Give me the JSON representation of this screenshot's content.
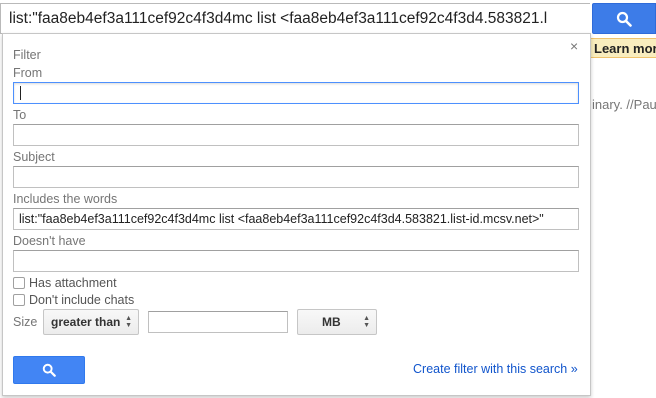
{
  "search": {
    "query": "list:\"faa8eb4ef3a111cef92c4f3d4mc list <faa8eb4ef3a111cef92c4f3d4.583821.l",
    "button_icon": "search-icon"
  },
  "background": {
    "learn_more": "Learn more",
    "snippet": "inary. //Paul"
  },
  "filter": {
    "close_glyph": "×",
    "heading": "Filter",
    "from_label": "From",
    "from_value": "",
    "to_label": "To",
    "to_value": "",
    "subject_label": "Subject",
    "subject_value": "",
    "includes_label": "Includes the words",
    "includes_value": "list:\"faa8eb4ef3a111cef92c4f3d4mc list <faa8eb4ef3a111cef92c4f3d4.583821.list-id.mcsv.net>\"",
    "doesnt_have_label": "Doesn't have",
    "doesnt_have_value": "",
    "has_attachment_label": "Has attachment",
    "no_chats_label": "Don't include chats",
    "size_label": "Size",
    "size_operator": "greater than",
    "size_value": "",
    "size_unit": "MB",
    "create_filter_link": "Create filter with this search »"
  },
  "colors": {
    "primary_blue": "#4285f4",
    "link_blue": "#1155cc",
    "focus_blue": "#4d90fe"
  }
}
